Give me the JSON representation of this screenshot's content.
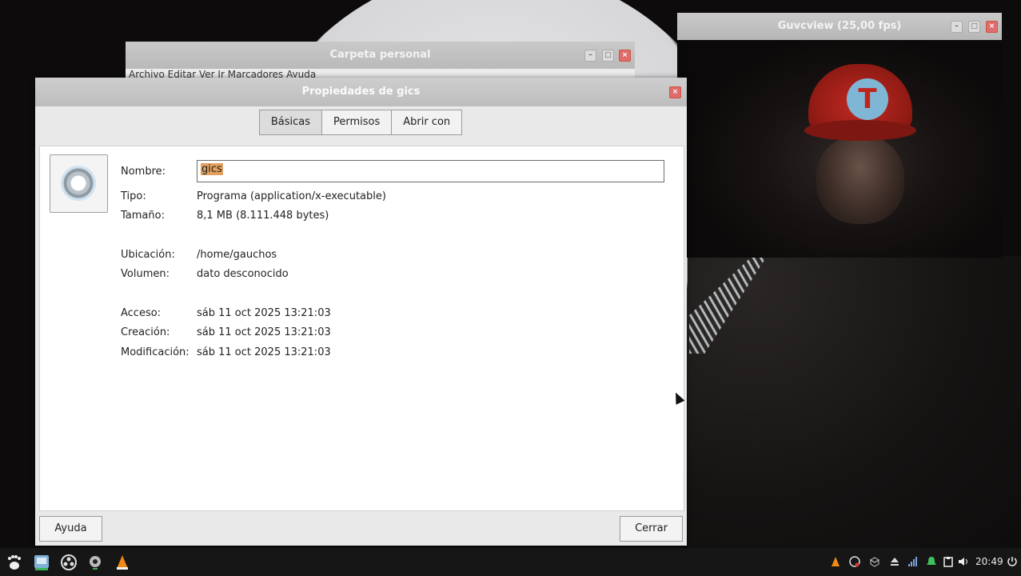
{
  "windows": {
    "background_title": "Carpeta personal",
    "background_menu": "Archivo  Editar  Ver  Ir  Marcadores  Ayuda",
    "webcam_title": "Guvcview  (25,00 fps)"
  },
  "dialog": {
    "title": "Propiedades de gics",
    "tabs": [
      "Básicas",
      "Permisos",
      "Abrir con"
    ],
    "fields": {
      "nombre_label": "Nombre:",
      "nombre_value": "gics",
      "tipo_label": "Tipo:",
      "tipo_value": "Programa (application/x-executable)",
      "tamano_label": "Tamaño:",
      "tamano_value": "8,1 MB (8.111.448 bytes)",
      "ubicacion_label": "Ubicación:",
      "ubicacion_value": "/home/gauchos",
      "volumen_label": "Volumen:",
      "volumen_value": "dato desconocido",
      "acceso_label": "Acceso:",
      "acceso_value": "sáb 11 oct 2025 13:21:03",
      "creacion_label": "Creación:",
      "creacion_value": "sáb 11 oct 2025 13:21:03",
      "modificacion_label": "Modificación:",
      "modificacion_value": "sáb 11 oct 2025 13:21:03"
    },
    "buttons": {
      "help": "Ayuda",
      "close": "Cerrar"
    }
  },
  "webcam": {
    "cap_letter": "T"
  },
  "taskbar": {
    "clock": "20:49",
    "icons": [
      "gnome-foot-icon",
      "file-manager-icon",
      "obs-icon",
      "webcam-icon",
      "vlc-icon"
    ],
    "tray": [
      "vlc-icon",
      "obs-icon",
      "dropbox-icon",
      "eject-icon",
      "signal-icon",
      "notification-icon",
      "clipboard-icon",
      "volume-icon",
      "power-icon"
    ]
  },
  "colors": {
    "selection": "#e2a05f",
    "close_button": "#e06c6c",
    "taskbar": "#161616"
  }
}
